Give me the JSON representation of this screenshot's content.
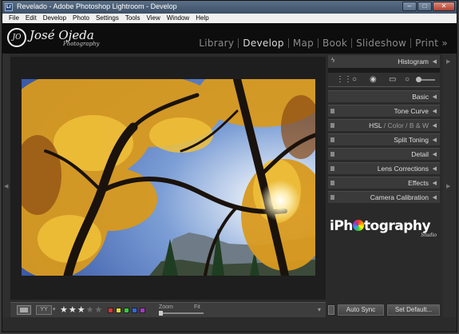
{
  "window": {
    "title": "Revelado - Adobe Photoshop Lightroom - Develop",
    "icon_label": "Lr",
    "controls": [
      "minimize-icon",
      "maximize-icon",
      "close-icon"
    ],
    "minimize_glyph": "–",
    "maximize_glyph": "□",
    "close_glyph": "✕"
  },
  "menu": [
    "File",
    "Edit",
    "Develop",
    "Photo",
    "Settings",
    "Tools",
    "View",
    "Window",
    "Help"
  ],
  "identity": {
    "mark": "JO",
    "name": "José Ojeda",
    "sub": "Photography"
  },
  "modules": [
    "Library",
    "Develop",
    "Map",
    "Book",
    "Slideshow",
    "Print »"
  ],
  "active_module": "Develop",
  "right_panel": {
    "histogram_label": "Histogram",
    "sections": [
      "Basic",
      "Tone Curve",
      "Split Toning",
      "Detail",
      "Lens Corrections",
      "Effects",
      "Camera Calibration"
    ],
    "hsl": {
      "parts": [
        "HSL",
        "Color",
        "B & W"
      ],
      "separator": "/"
    },
    "brand": {
      "prefix": "iPh",
      "suffix": "tography",
      "studio": "Studio"
    },
    "buttons": {
      "auto_sync": "Auto Sync",
      "set_default": "Set Default..."
    }
  },
  "toolbar": {
    "yy_label": "YY",
    "rating": 3,
    "rating_max": 5,
    "color_labels": [
      "#d33",
      "#dd3",
      "#3c3",
      "#36d",
      "#a3c"
    ],
    "zoom_label": "Zoom",
    "zoom_value": "Fit"
  },
  "colors": {
    "accent": "#d8d8d8",
    "panel_bg": "#2a2a2a"
  }
}
